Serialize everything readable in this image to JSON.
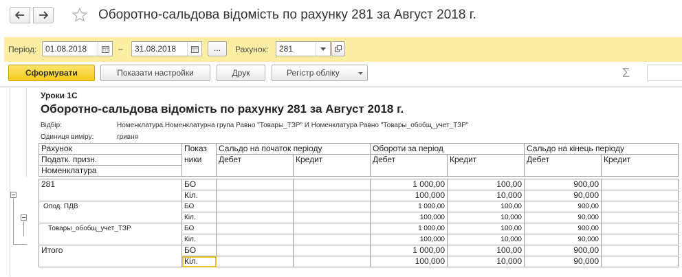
{
  "window": {
    "title": "Оборотно-сальдова відомість по рахунку 281 за Август 2018 г."
  },
  "params": {
    "period_label": "Період:",
    "date_from": "01.08.2018",
    "dash": "–",
    "date_to": "31.08.2018",
    "ellipsis": "...",
    "account_label": "Рахунок:",
    "account_value": "281"
  },
  "toolbar": {
    "generate": "Сформувати",
    "show_settings": "Показати настройки",
    "print": "Друк",
    "register": "Регістр обліку",
    "sigma": "Σ"
  },
  "report": {
    "org": "Уроки 1С",
    "title": "Оборотно-сальдова відомість по рахунку 281 за Август 2018 г.",
    "filter_label": "Відбір:",
    "filter_value": "Номенклатура.Номенклатурна група Равно \"Товары_ТЗР\" И Номенклатура Равно \"Товары_обобщ_учет_ТЗР\"",
    "unit_label": "Одиниця виміру:",
    "unit_value": "гривня",
    "headers": {
      "account": "Рахунок",
      "tax": "Податк. призн.",
      "nomenclature": "Номенклатура",
      "indicators_1": "Показ",
      "indicators_2": "ники",
      "opening": "Сальдо на початок періоду",
      "turnover": "Обороти за період",
      "closing": "Сальдо на кінець періоду",
      "debit": "Дебет",
      "credit": "Кредит"
    },
    "rows": {
      "r281": {
        "name": "281",
        "bo": {
          "ind": "БО",
          "turn_debit": "1 000,00",
          "turn_credit": "100,00",
          "close_debit": "900,00"
        },
        "qty": {
          "ind": "Кіл.",
          "turn_debit": "100,000",
          "turn_credit": "10,000",
          "close_debit": "90,000"
        }
      },
      "vat": {
        "name": "Опод. ПДВ",
        "bo": {
          "ind": "БО",
          "turn_debit": "1 000,00",
          "turn_credit": "100,00",
          "close_debit": "900,00"
        },
        "qty": {
          "ind": "Кіл.",
          "turn_debit": "100,000",
          "turn_credit": "10,000",
          "close_debit": "90,000"
        }
      },
      "item": {
        "name": "Товары_обобщ_учет_ТЗР",
        "bo": {
          "ind": "БО",
          "turn_debit": "1 000,00",
          "turn_credit": "100,00",
          "close_debit": "900,00"
        },
        "qty": {
          "ind": "Кіл.",
          "turn_debit": "100,000",
          "turn_credit": "10,000",
          "close_debit": "90,000"
        }
      },
      "total": {
        "name": "Итого",
        "bo": {
          "ind": "БО",
          "turn_debit": "1 000,00",
          "turn_credit": "100,00",
          "close_debit": "900,00"
        },
        "qty": {
          "ind": "Кіл.",
          "turn_debit": "100,000",
          "turn_credit": "10,000",
          "close_debit": "90,000"
        }
      }
    }
  },
  "colors": {
    "param_bar": "#fbeda2",
    "primary_button": "#f4cc1b",
    "selection": "#e8c437"
  }
}
